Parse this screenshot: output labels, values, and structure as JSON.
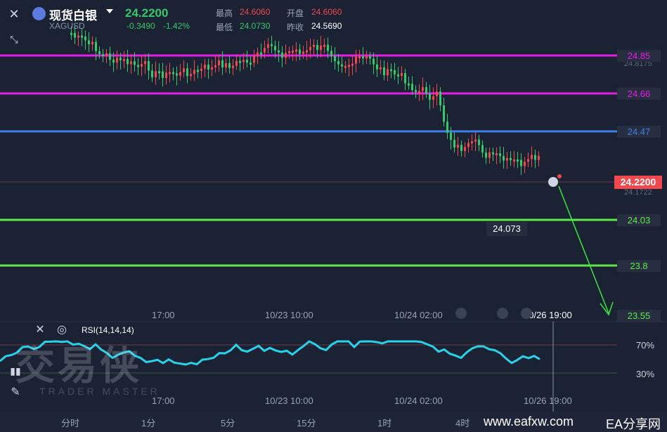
{
  "header": {
    "close_icon": "close-icon",
    "collapse_icon": "collapse-arrows-icon",
    "title": "现货白银",
    "symbol": "XAGUSD",
    "price": "24.2200",
    "change": "-0.3490",
    "change_pct": "-1.42%",
    "high_label": "最高",
    "high": "24.6060",
    "open_label": "开盘",
    "open": "24.6060",
    "low_label": "最低",
    "low": "24.0730",
    "prev_close_label": "昨收",
    "prev_close": "24.5690"
  },
  "levels": [
    {
      "label": "24.85",
      "color": "#e81ce8"
    },
    {
      "label": "24.66",
      "color": "#e81ce8"
    },
    {
      "label": "24.47",
      "color": "#3f7fe8"
    },
    {
      "label": "24.03",
      "color": "#5fe84a"
    },
    {
      "label": "23.8",
      "color": "#5fe84a"
    },
    {
      "label": "23.55",
      "color": "#5fe84a"
    }
  ],
  "current_price_tag": "24.2200",
  "axis_scale": [
    "24.8175",
    "24.1722"
  ],
  "low_marker": "24.073",
  "time_labels": [
    "17:00",
    "10/23 10:00",
    "10/24 02:00",
    "10/26 19:00"
  ],
  "rsi": {
    "title": "RSI(14,14,14)",
    "upper": "70%",
    "lower": "30%",
    "color": "#29d2e8"
  },
  "periods": [
    "分时",
    "1分",
    "5分",
    "15分",
    "1时",
    "4时"
  ],
  "watermark_cn": "交易侠",
  "watermark_en": "TRADER MASTER",
  "site": "www.eafxw.com",
  "site2": "EA分享网",
  "colors": {
    "up": "#f0484d",
    "down": "#37c86a",
    "background": "#1b2233"
  }
}
